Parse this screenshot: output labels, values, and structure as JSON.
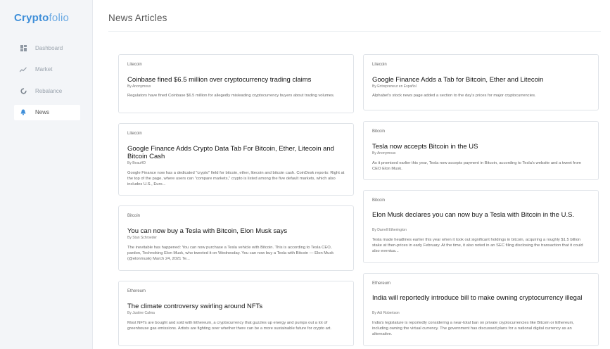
{
  "app": {
    "logo_bold": "Crypto",
    "logo_rest": "folio"
  },
  "sidebar": {
    "items": [
      {
        "label": "Dashboard",
        "icon": "dashboard-icon"
      },
      {
        "label": "Market",
        "icon": "trend-icon"
      },
      {
        "label": "Rebalance",
        "icon": "rebalance-icon"
      },
      {
        "label": "News",
        "icon": "bell-icon",
        "active": true
      }
    ]
  },
  "main": {
    "title": "News Articles"
  },
  "articles": [
    {
      "category": "Litecoin",
      "title": "Coinbase fined $6.5 million over cryptocurrency trading claims",
      "author": "By Anonymous",
      "description": "Regulators have fined Coinbase $6.5 million for allegedly misleading cryptocurrency buyers about trading volumes."
    },
    {
      "category": "Litecoin",
      "title": "Google Finance Adds Crypto Data Tab For Bitcoin, Ether, Litecoin and Bitcoin Cash",
      "author": "By BeauHD",
      "description": "Google Finance now has a dedicated \"crypto\" field for bitcoin, ether, litecoin and bitcoin cash. CoinDesk reports: Right at the top of the page, where users can \"compare markets,\" crypto is listed among the five default markets, which also includes U.S., Euro..."
    },
    {
      "category": "Bitcoin",
      "title": "You can now buy a Tesla with Bitcoin, Elon Musk says",
      "author": "By Stan Schroeder",
      "description": "The inevitable has happened: You can now purchase a Tesla vehicle with Bitcoin.  This is according to Tesla CEO, pardon, Technoking Elon Musk, who tweeted it on Wednesday.  You can now buy a Tesla with Bitcoin — Elon Musk (@elonmusk) March 24, 2021 Te..."
    },
    {
      "category": "Ethereum",
      "title": "The climate controversy swirling around NFTs",
      "author": "By Justine Calma",
      "description": "Most NFTs are bought and sold with Ethereum, a cryptocurrency that guzzles up energy and pumps out a lot of greenhouse gas emissions. Artists are fighting over whether there can be a more sustainable future for crypto art."
    },
    {
      "category": "Litecoin",
      "title": "Google Finance Adds a Tab for Bitcoin, Ether and Litecoin",
      "author": "By Entrepreneur en Español",
      "description": "Alphabet's stock news page added a section to the day's prices for major cryptocurrencies."
    },
    {
      "category": "Bitcoin",
      "title": "Tesla now accepts Bitcoin in the US",
      "author": "By Anonymous",
      "description": "As it promised earlier this year, Tesla now accepts payment in Bitcoin, according to Tesla's website and a tweet from CEO Elon Musk."
    },
    {
      "category": "Bitcoin",
      "title": "Elon Musk declares you can now buy a Tesla with Bitcoin in the U.S.",
      "author": "By Darrell Etherington",
      "description": "Tesla made headlines earlier this year when it took out significant holdings in bitcoin, acquiring a roughly $1.5 billion stake at then-prices in early February. At the time, it also noted in an SEC filing disclosing the transaction that it could also eventua..."
    },
    {
      "category": "Ethereum",
      "title": "India will reportedly introduce bill to make owning cryptocurrency illegal",
      "author": "By Adi Robertson",
      "description": "India's legislature is reportedly considering a near-total ban on private cryptocurrencies like Bitcoin or Ethereum, including owning the virtual currency. The government has discussed plans for a national digital currency as an alternative."
    }
  ]
}
